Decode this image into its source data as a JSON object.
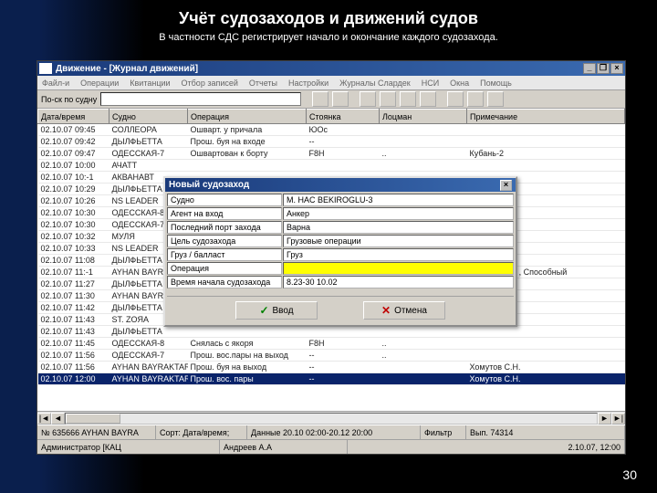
{
  "slide": {
    "title": "Учёт судозаходов и движений судов",
    "subtitle": "В частности СДС регистрирует начало и окончание каждого судозахода.",
    "pagenum": "30"
  },
  "window": {
    "title": "Движение - [Журнал движений]",
    "minimize": "_",
    "restore": "❐",
    "close": "×"
  },
  "menu": [
    "Файл-и",
    "Операции",
    "Квитанции",
    "Отбор записей",
    "Отчеты",
    "Настройки",
    "Журналы Слардек",
    "НСИ",
    "Окна",
    "Помощь"
  ],
  "searchbar": {
    "label": "По-ск по судну"
  },
  "columns": [
    "Дата/время",
    "Судно",
    "Операция",
    "Стоянка",
    "Лоцман",
    "Примечание"
  ],
  "rows": [
    {
      "dt": "02.10.07 09:45",
      "ship": "СОЛЛЕОРА",
      "op": "Ошварт. у причала",
      "st": "ЮОс",
      "lm": "",
      "note": ""
    },
    {
      "dt": "02.10.07 09:42",
      "ship": "ДЫЛФЬЕТТА",
      "op": "Прош. буя на входе",
      "st": "--",
      "lm": "",
      "note": ""
    },
    {
      "dt": "02.10.07 09:47",
      "ship": "ОДЕССКАЯ-7",
      "op": "Ошвартован к борту",
      "st": "F8H",
      "lm": "..",
      "note": "Кубань-2"
    },
    {
      "dt": "02.10.07 10:00",
      "ship": "АЧАТТ",
      "op": "",
      "st": "",
      "lm": "",
      "note": ""
    },
    {
      "dt": "02.10.07 10:-1",
      "ship": "АКВАНАВТ",
      "op": "",
      "st": "",
      "lm": "",
      "note": ""
    },
    {
      "dt": "02.10.07 10:29",
      "ship": "ДЫЛФЬЕТТА",
      "op": "",
      "st": "",
      "lm": "",
      "note": ""
    },
    {
      "dt": "02.10.07 10:26",
      "ship": "NS LEADER",
      "op": "",
      "st": "",
      "lm": "",
      "note": ""
    },
    {
      "dt": "02.10.07 10:30",
      "ship": "ОДЕССКАЯ-8",
      "op": "",
      "st": "",
      "lm": "",
      "note": ""
    },
    {
      "dt": "02.10.07 10:30",
      "ship": "ОДЕССКАЯ-7",
      "op": "",
      "st": "",
      "lm": "",
      "note": ""
    },
    {
      "dt": "02.10.07 10:32",
      "ship": "МУЛЯ",
      "op": "",
      "st": "",
      "lm": "",
      "note": ""
    },
    {
      "dt": "02.10.07 10:33",
      "ship": "NS LEADER",
      "op": "",
      "st": "",
      "lm": "",
      "note": ""
    },
    {
      "dt": "02.10.07 11:08",
      "ship": "ДЫЛФЬЕТТА",
      "op": "",
      "st": "",
      "lm": "",
      "note": ""
    },
    {
      "dt": "02.10.07 11:-1",
      "ship": "AYHAN BAYRAI",
      "op": "",
      "st": "",
      "lm": "",
      "note": "Сторожилов , Способный"
    },
    {
      "dt": "02.10.07 11:27",
      "ship": "ДЫЛФЬЕТТА",
      "op": "",
      "st": "",
      "lm": "",
      "note": ""
    },
    {
      "dt": "02.10.07 11:30",
      "ship": "AYHAN BAYRAI",
      "op": "",
      "st": "",
      "lm": "",
      "note": ""
    },
    {
      "dt": "02.10.07 11:42",
      "ship": "ДЫЛФЬЕТТА",
      "op": "",
      "st": "",
      "lm": "",
      "note": ""
    },
    {
      "dt": "02.10.07 11:43",
      "ship": "ST. ZOЯA",
      "op": "",
      "st": "",
      "lm": "",
      "note": ""
    },
    {
      "dt": "02.10.07 11:43",
      "ship": "ДЫЛФЬЕТТА",
      "op": "",
      "st": "",
      "lm": "",
      "note": ""
    },
    {
      "dt": "02.10.07 11:45",
      "ship": "ОДЕССКАЯ-8",
      "op": "Снялась с якоря",
      "st": "F8H",
      "lm": "..",
      "note": ""
    },
    {
      "dt": "02.10.07 11:56",
      "ship": "ОДЕССКАЯ-7",
      "op": "Прош. вос.пары на выход",
      "st": "--",
      "lm": "..",
      "note": ""
    },
    {
      "dt": "02.10.07 11:56",
      "ship": "AYHAN BAYRAKTAR",
      "op": "Прош. буя на выход",
      "st": "--",
      "lm": "",
      "note": "Хомутов С.Н."
    },
    {
      "dt": "02.10.07 12:00",
      "ship": "AYHAN BAYRAKTAR",
      "op": "Прош. вос. пары",
      "st": "--",
      "lm": "",
      "note": "Хомутов С.Н.",
      "sel": true
    }
  ],
  "dialog": {
    "title": "Новый судозаход",
    "close": "×",
    "fields": [
      {
        "label": "Судно",
        "value": "M. HAC BEKIROGLU-3"
      },
      {
        "label": "Агент на вход",
        "value": "Анкер"
      },
      {
        "label": "Последний порт захода",
        "value": "Варна"
      },
      {
        "label": "Цель судозахода",
        "value": "Грузовые операции"
      },
      {
        "label": "Груз / балласт",
        "value": "Груз"
      },
      {
        "label": "Операция",
        "value": "",
        "yellow": true
      },
      {
        "label": "Время начала судозахода",
        "value": "8.23-30 10.02"
      }
    ],
    "ok": "Ввод",
    "cancel": "Отмена"
  },
  "status1": {
    "rec": "№ 635666 AYHAN BAYRA",
    "sort": "Сорт: Дата/время;",
    "data": "Данные 20.10 02:00-20.12 20:00",
    "filter": "Фильтр",
    "extra": "Вып. 74314"
  },
  "status2": {
    "user": "Администратор [КАЦ",
    "name": "Андреев А.А",
    "time": "2.10.07, 12:00"
  }
}
